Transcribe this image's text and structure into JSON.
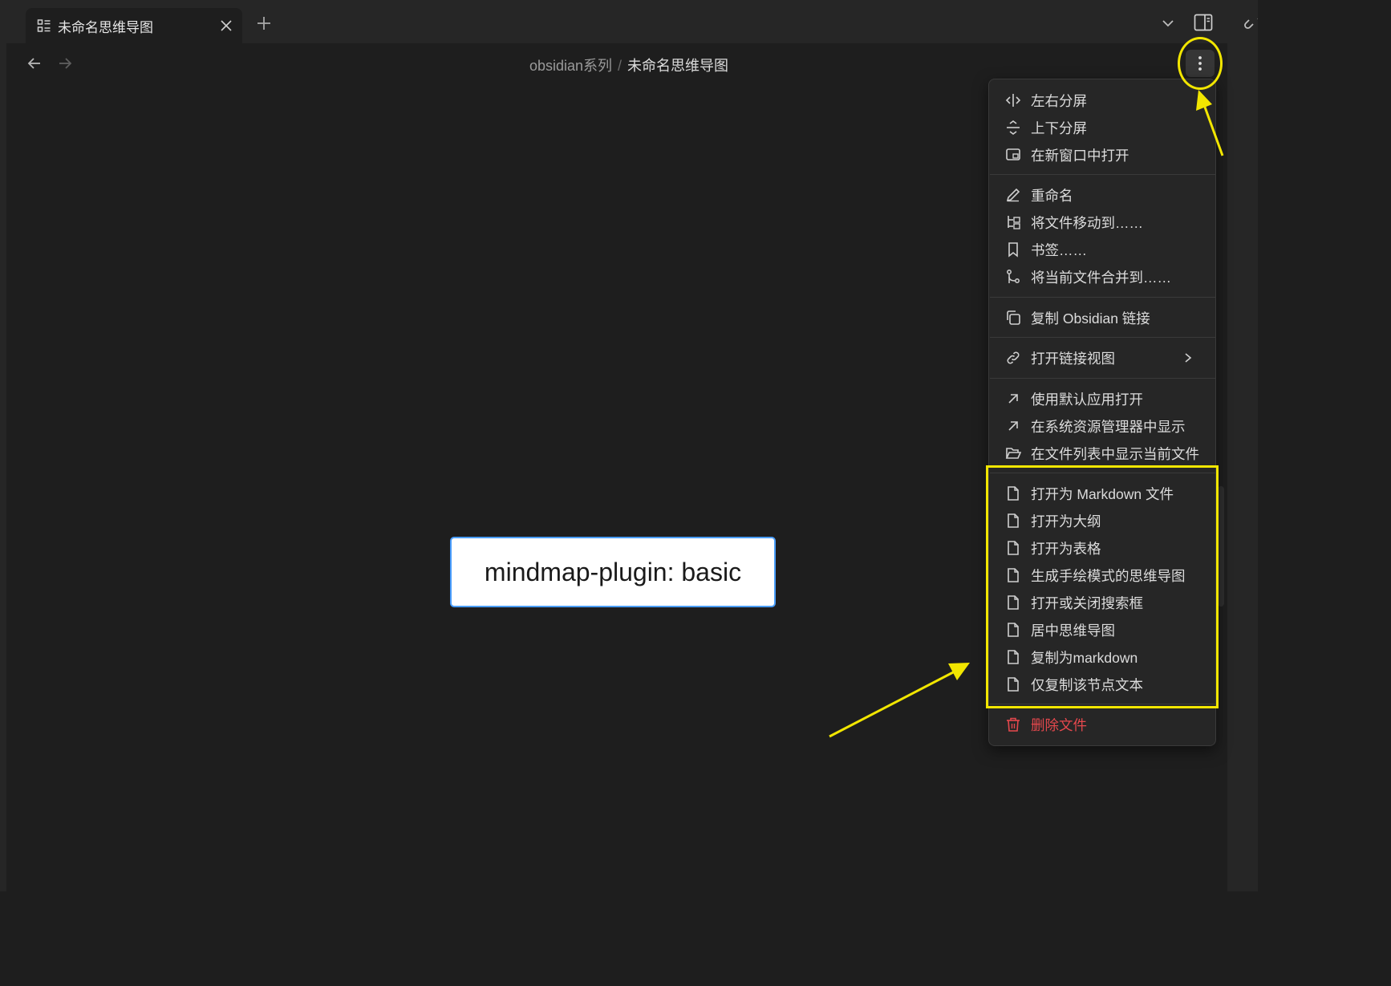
{
  "tab": {
    "title": "未命名思维导图",
    "icon": "layout-list-icon",
    "close_icon": "close-icon"
  },
  "toolbar": {
    "new_tab_icon": "plus-icon",
    "tab_list_icon": "chevron-down-icon",
    "sidebar_toggle_icon": "sidebar-right-icon",
    "link_icon": "link-icon"
  },
  "nav": {
    "back_icon": "arrow-left-icon",
    "forward_icon": "arrow-right-icon"
  },
  "breadcrumb": {
    "parent": "obsidian系列",
    "separator": "/",
    "current": "未命名思维导图"
  },
  "more_options_icon": "more-vertical-icon",
  "mindmap": {
    "root_text": "mindmap-plugin: basic"
  },
  "menu": {
    "items": [
      {
        "label": "左右分屏",
        "icon": "split-horizontal-icon"
      },
      {
        "label": "上下分屏",
        "icon": "split-vertical-icon"
      },
      {
        "label": "在新窗口中打开",
        "icon": "new-window-icon"
      },
      {
        "label": "重命名",
        "icon": "pencil-icon"
      },
      {
        "label": "将文件移动到……",
        "icon": "folder-tree-icon"
      },
      {
        "label": "书签……",
        "icon": "bookmark-icon"
      },
      {
        "label": "将当前文件合并到……",
        "icon": "git-merge-icon"
      },
      {
        "label": "复制 Obsidian 链接",
        "icon": "copy-icon"
      },
      {
        "label": "打开链接视图",
        "icon": "link-icon",
        "submenu": true
      },
      {
        "label": "使用默认应用打开",
        "icon": "arrow-up-right-icon"
      },
      {
        "label": "在系统资源管理器中显示",
        "icon": "arrow-up-right-icon"
      },
      {
        "label": "在文件列表中显示当前文件",
        "icon": "folder-open-icon"
      },
      {
        "label": "打开为 Markdown 文件",
        "icon": "file-icon"
      },
      {
        "label": "打开为大纲",
        "icon": "file-icon"
      },
      {
        "label": "打开为表格",
        "icon": "file-icon"
      },
      {
        "label": "生成手绘模式的思维导图",
        "icon": "file-icon"
      },
      {
        "label": "打开或关闭搜索框",
        "icon": "file-icon"
      },
      {
        "label": "居中思维导图",
        "icon": "file-icon"
      },
      {
        "label": "复制为markdown",
        "icon": "file-icon"
      },
      {
        "label": "仅复制该节点文本",
        "icon": "file-icon"
      },
      {
        "label": "删除文件",
        "icon": "trash-icon",
        "danger": true
      }
    ]
  },
  "colors": {
    "background": "#1e1e1e",
    "chrome": "#262626",
    "menu_bg": "#262626",
    "danger": "#e5484d",
    "annotation": "#f2e600",
    "node_border": "#4a9eff"
  }
}
